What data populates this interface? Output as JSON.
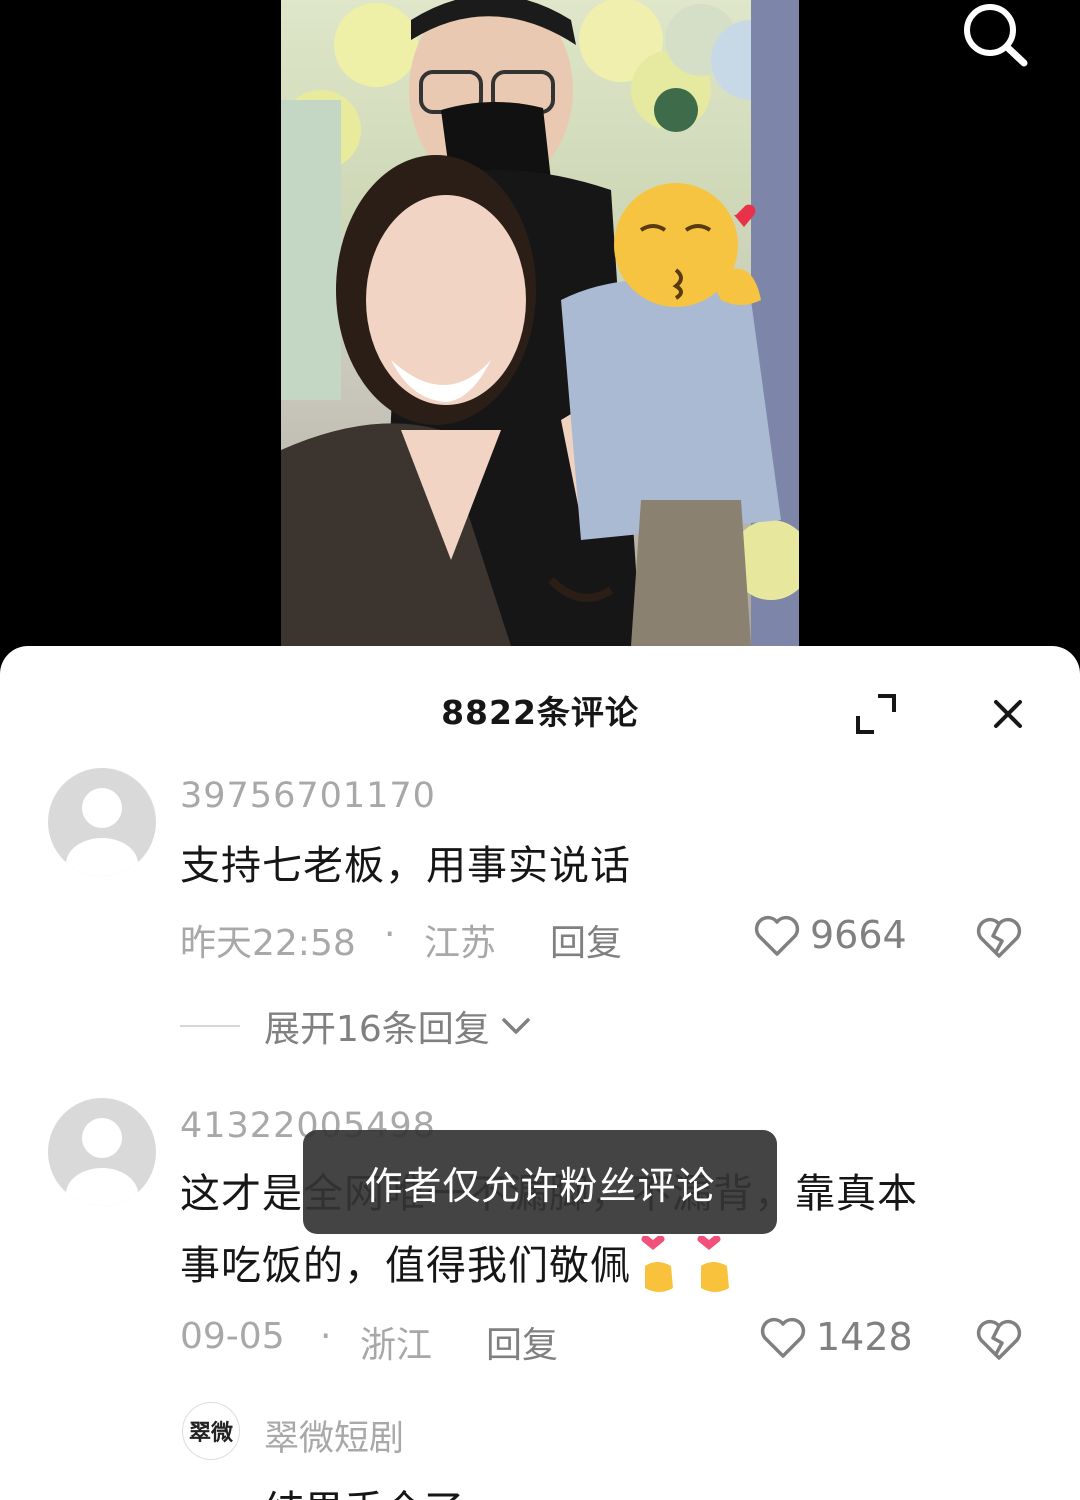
{
  "comments_panel": {
    "title": "8822条评论",
    "comments": [
      {
        "username": "39756701170",
        "text": "支持七老板，用事实说话",
        "time": "昨天22:58",
        "separator": "·",
        "location": "江苏",
        "reply_label": "回复",
        "likes": "9664",
        "expand_replies": "展开16条回复"
      },
      {
        "username": "41322005498",
        "text_line1": "这才是全网唯一不漏脚，不漏背，靠真本",
        "text_line2": "事吃饭的，值得我们敬佩",
        "time": "09-05",
        "separator": "·",
        "location": "浙江",
        "reply_label": "回复",
        "likes": "1428"
      }
    ],
    "sub_reply": {
      "avatar_text": "翠微",
      "username": "翠微短剧",
      "text": "结果丢全了"
    }
  },
  "toast": {
    "message": "作者仅允许粉丝评论"
  },
  "icons": {
    "search": "search-icon",
    "expand": "expand-icon",
    "close": "close-icon",
    "like": "heart-icon",
    "dislike": "broken-heart-icon",
    "chevron": "chevron-down-icon"
  },
  "colors": {
    "panel_bg": "#ffffff",
    "primary_text": "#161616",
    "secondary_text": "#a8a8a8",
    "toast_bg": "#343434"
  }
}
